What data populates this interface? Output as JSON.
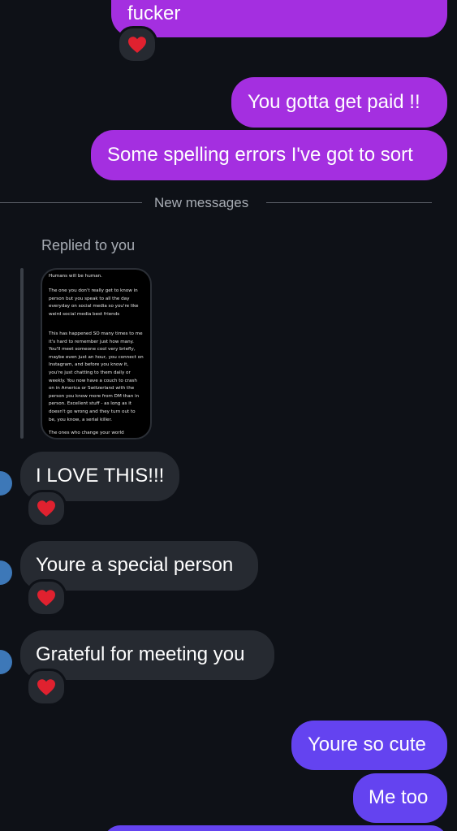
{
  "colors": {
    "background": "#0e1117",
    "outgoing_purple": "#a42fe0",
    "outgoing_violet": "#6443f0",
    "incoming": "#262a31",
    "heart": "#e0212f"
  },
  "messages": [
    {
      "text": "fucker",
      "reaction": "❤️"
    },
    {
      "text": "You gotta get paid !!"
    },
    {
      "text": "Some spelling errors I've got to sort"
    }
  ],
  "divider": {
    "label": "New messages"
  },
  "reply": {
    "label": "Replied to you",
    "story_lines": {
      "top": "Humans will be human.",
      "p1": "The one you don't really get to know in person but you speak to all the day everyday on social media so you're like weird social media best friends",
      "p2": "This has happened SO many times to me it's hard to remember just how many. You'll meet someone cool very briefly, maybe even just an hour, you connect on Instagram, and before you know it, you're just chatting to them daily or weekly. You now have a couch to crash on in America or Switzerland with the person you know more from DM than in person. Excellent stuff - as long as it doesn't go wrong and they turn out to be, you know, a serial killer.",
      "bottom": "The ones who change your world whether"
    }
  },
  "incoming": [
    {
      "text": "I LOVE THIS!!!",
      "reaction": "❤️"
    },
    {
      "text": "Youre a special person",
      "reaction": "❤️"
    },
    {
      "text": "Grateful for meeting you",
      "reaction": "❤️"
    }
  ],
  "outgoing_recent": [
    {
      "text": "Youre so cute"
    },
    {
      "text": "Me too"
    }
  ]
}
